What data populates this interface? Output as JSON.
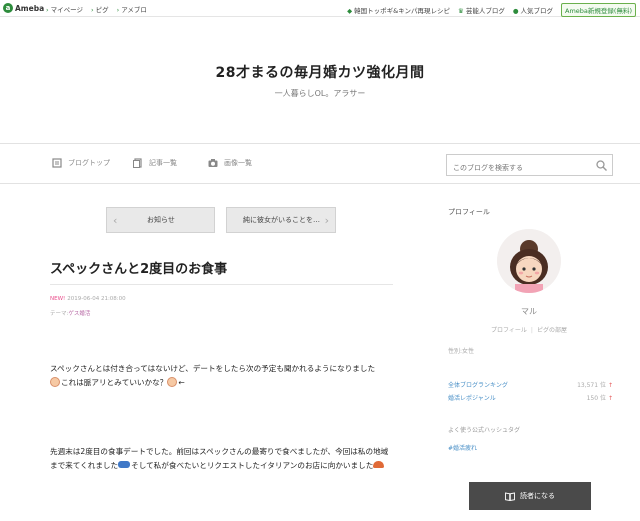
{
  "topbar": {
    "logo": "Ameba",
    "nav": [
      "マイページ",
      "ピグ",
      "アメブロ"
    ],
    "right_links": [
      "韓国トッポギ&キンパ再現レシピ",
      "芸能人ブログ",
      "人気ブログ"
    ],
    "signup": "Ameba新規登録(無料)"
  },
  "header": {
    "title": "28才まるの毎月婚カツ強化月間",
    "description": "一人暮らしOL。アラサー"
  },
  "nav": {
    "blog_top": "ブログトップ",
    "articles": "記事一覧",
    "images": "画像一覧",
    "search_placeholder": "このブログを検索する"
  },
  "pager": {
    "prev": "お知らせ",
    "next": "純に彼女がいることを…"
  },
  "entry": {
    "title": "スペックさんと2度目のお食事",
    "new_badge": "NEW!",
    "date": "2019-06-04 21:08:00",
    "theme_prefix": "テーマ:",
    "theme": "ゲス婚活",
    "p1_a": "スペックさんとは付き合ってはないけど、デートをしたら次の予定も聞かれるようになりました",
    "p1_b": "これは脈アリとみていいかな？",
    "p1_c": "←",
    "p2_a": "先週末は2度目の食事デートでした。前回はスペックさんの最寄りで食べましたが、今回は私の地域まで来てくれました",
    "p2_b": "そして私が食べたいとリクエストしたイタリアンのお店に向かいました"
  },
  "sidebar": {
    "heading": "プロフィール",
    "name": "マル",
    "profile_link": "プロフィール",
    "pig_link": "ピグの部屋",
    "gender": "性別:女性",
    "rank1_label": "全体ブログランキング",
    "rank1_value": "13,571 位",
    "rank2_label": "婚活レポジャンル",
    "rank2_value": "150 位",
    "rank_arrow": "↑",
    "hashtag_heading": "よく使う公式ハッシュタグ",
    "hashtag": "#婚活疲れ",
    "reader_button": "読者になる"
  }
}
